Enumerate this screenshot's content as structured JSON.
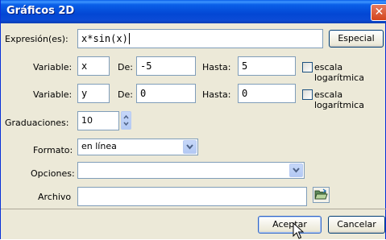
{
  "window": {
    "title": "Gráficos 2D",
    "close_glyph": "✕"
  },
  "expression": {
    "label": "Expresión(es):",
    "value": "x*sin(x)",
    "special_button": "Especial"
  },
  "var1": {
    "label": "Variable:",
    "name": "x",
    "from_label": "De:",
    "from": "-5",
    "to_label": "Hasta:",
    "to": "5",
    "log_label": "escala logarítmica"
  },
  "var2": {
    "label": "Variable:",
    "name": "y",
    "from_label": "De:",
    "from": "0",
    "to_label": "Hasta:",
    "to": "0",
    "log_label": "escala logarítmica"
  },
  "ticks": {
    "label": "Graduaciones:",
    "value": "10"
  },
  "format": {
    "label": "Formato:",
    "value": "en línea"
  },
  "options": {
    "label": "Opciones:",
    "value": ""
  },
  "file": {
    "label": "Archivo",
    "value": "",
    "browse_icon": "folder-open-icon"
  },
  "buttons": {
    "ok": "Aceptar",
    "cancel": "Cancelar"
  }
}
